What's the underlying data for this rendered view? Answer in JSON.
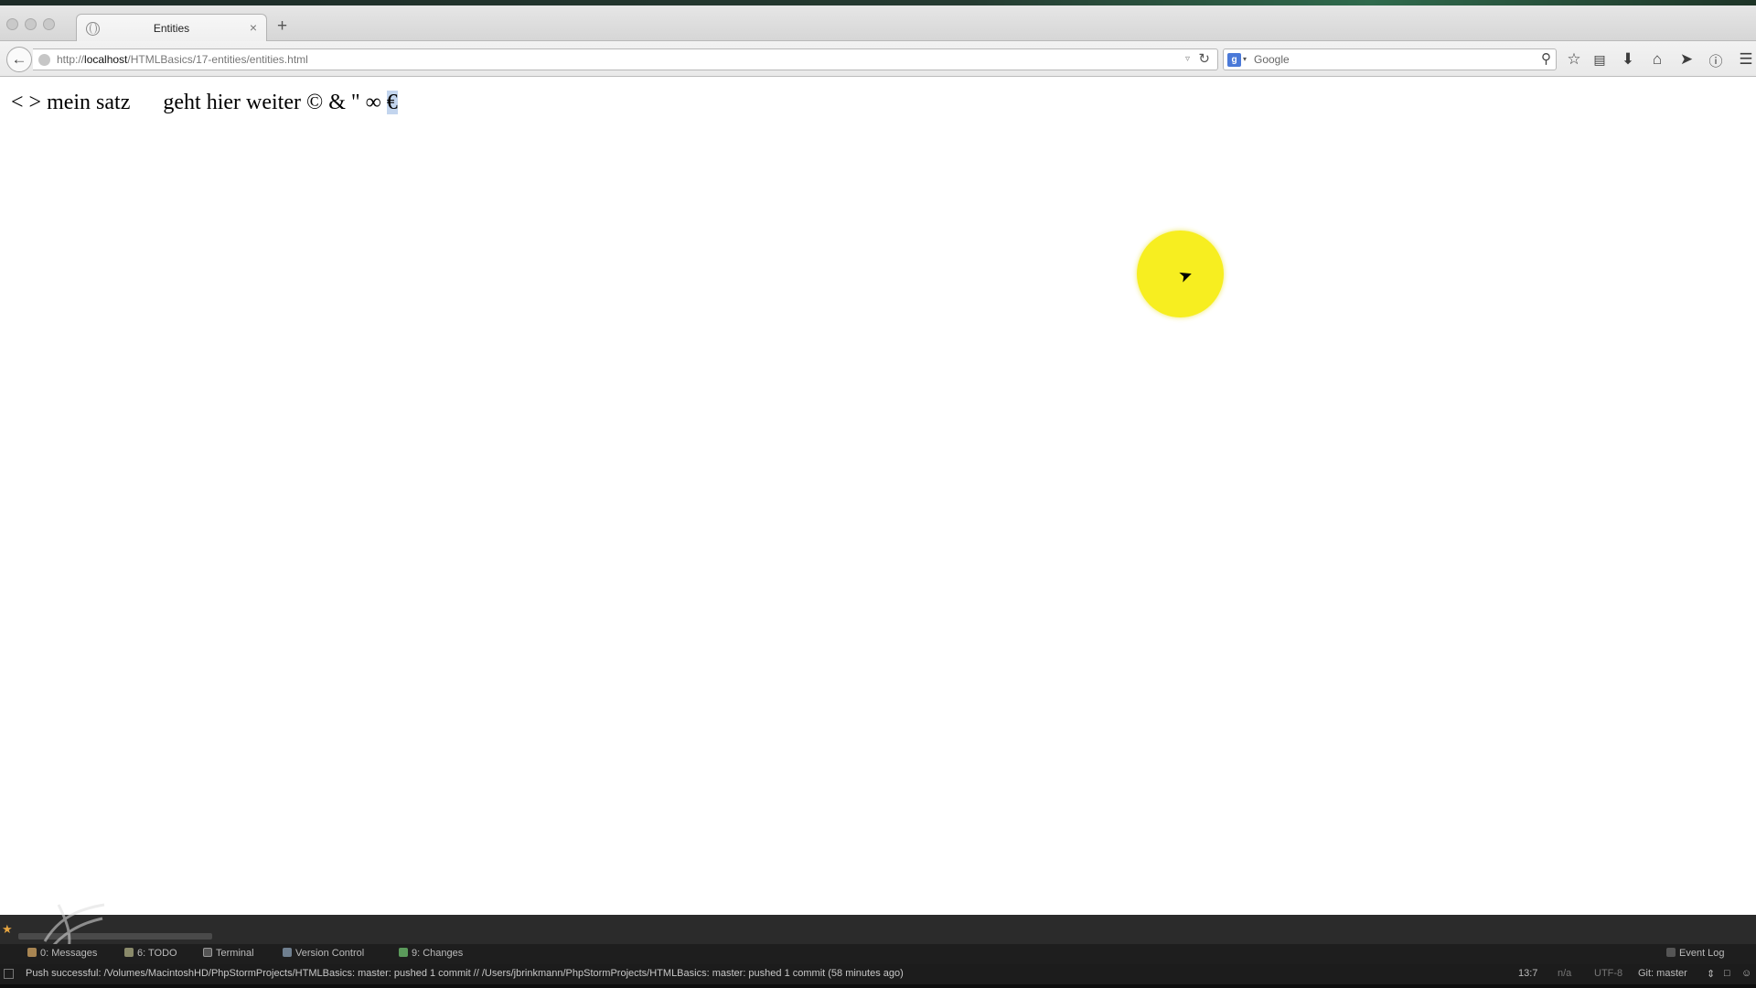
{
  "browser": {
    "tab_title": "Entities",
    "tab_close": "×",
    "new_tab": "+",
    "url_prefix": "http://",
    "url_host": "localhost",
    "url_path": "/HTMLBasics/17-entities/entities.html",
    "search_placeholder": "Google",
    "search_engine_icon": "google-icon"
  },
  "page": {
    "entity_text": "< > mein satz      geht hier weiter © & \" ∞ ",
    "selected_text": "€"
  },
  "ide": {
    "tabs": [
      {
        "label": "0: Messages",
        "icon": "messages-icon"
      },
      {
        "label": "6: TODO",
        "icon": "todo-icon"
      },
      {
        "label": "Terminal",
        "icon": "terminal-icon"
      },
      {
        "label": "Version Control",
        "icon": "version-control-icon"
      },
      {
        "label": "9: Changes",
        "icon": "changes-icon"
      }
    ],
    "event_log": "Event Log",
    "status_message": "Push successful: /Volumes/MacintoshHD/PhpStormProjects/HTMLBasics: master: pushed 1 commit // /Users/jbrinkmann/PhpStormProjects/HTMLBasics: master: pushed 1 commit (58 minutes ago)",
    "cursor_position": "13:7",
    "na": "n/a",
    "encoding": "UTF-8",
    "git_branch": "Git: master"
  },
  "colors": {
    "highlight": "#f7ee20",
    "selection": "#c3d5ee",
    "ide_background": "#2b2b2b"
  }
}
